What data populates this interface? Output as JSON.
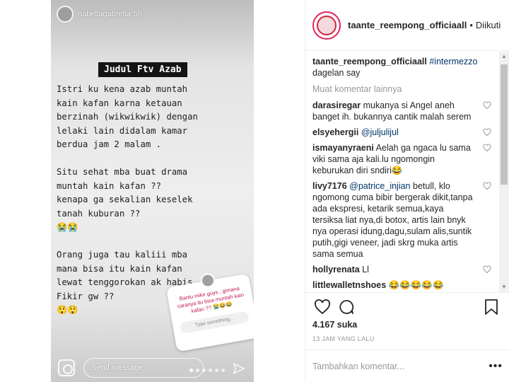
{
  "story": {
    "username": "nabellagabrella",
    "time": "5h",
    "title": "Judul Ftv Azab",
    "body": "Istri ku kena azab muntah\nkain kafan karna ketauan\nberzinah (wikwikwik) dengan\nlelaki lain didalam kamar\nberdua jam 2 malam .\n\nSitu sehat mba buat drama\nmuntah kain kafan ??\nkenapa ga sekalian keselek\ntanah kuburan ??\n😭😭\n\nOrang juga tau kaliii mba\nmana bisa itu kain kafan\nlewat tenggorokan ak habis\nFikir gw ??\n😲😲",
    "poll_question": "Bantu mikir guys , gimana caranya itu bisa muntah kain kafan ?? 😭😂😂",
    "poll_placeholder": "Type something...",
    "send_message_placeholder": "Send message"
  },
  "header": {
    "username": "taante_reempong_officiaall",
    "separator": "•",
    "follow_state": "Diikuti"
  },
  "caption": {
    "username": "taante_reempong_officiaall",
    "hashtag": "#intermezzo",
    "text": "dagelan say"
  },
  "more_comments_label": "Muat komentar lainnya",
  "comments": [
    {
      "user": "darasiregar",
      "text": "mukanya si Angel aneh banget ih. bukannya cantik malah serem"
    },
    {
      "user": "elsyehergii",
      "mention": "@juljulijul",
      "text": ""
    },
    {
      "user": "ismayanyraeni",
      "text": "Aelah ga ngaca lu sama viki sama aja kali.lu ngomongin keburukan diri sndiri😂"
    },
    {
      "user": "livy7176",
      "mention": "@patrice_injian",
      "text": "betull, klo ngomong cuma bibir bergerak dikit,tanpa ada ekspresi, ketarik semua,kaya tersiksa liat nya,di botox, artis lain bnyk nya operasi idung,dagu,sulam alis,suntik putih,gigi veneer, jadi skrg muka artis sama semua"
    },
    {
      "user": "hollyrenata",
      "text": "Ll"
    },
    {
      "user": "littlewalletnshoes",
      "text": "😂😂😂😂😂"
    }
  ],
  "likes": {
    "count": "4.167",
    "label": "suka"
  },
  "time_ago": "13 JAM YANG LALU",
  "add_comment_placeholder": "Tambahkan komentar...",
  "more_options": "•••",
  "colors": {
    "accent_link": "#003569",
    "muted": "#999999",
    "border": "#efefef"
  }
}
